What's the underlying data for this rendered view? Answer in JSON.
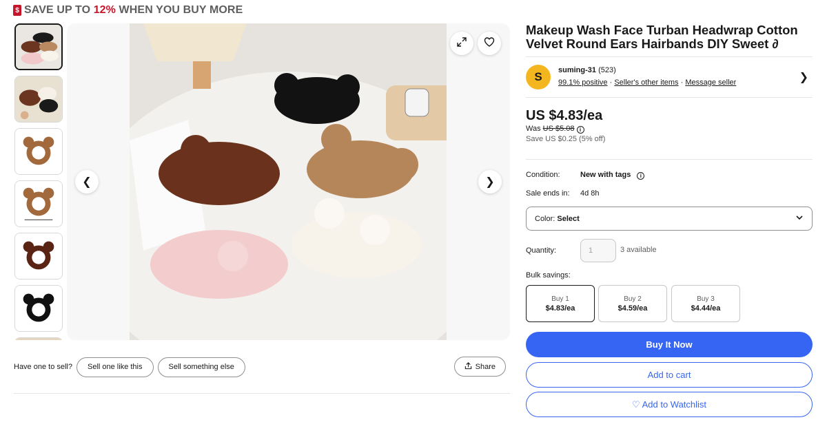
{
  "promo": {
    "icon": "$",
    "text_before": "SAVE UP TO ",
    "percent": "12%",
    "text_after": " WHEN YOU BUY MORE",
    "accent_color": "#c7162b"
  },
  "gallery": {
    "thumbnails": [
      {
        "name": "thumb-1",
        "active": true
      },
      {
        "name": "thumb-2",
        "active": false
      },
      {
        "name": "thumb-3",
        "active": false
      },
      {
        "name": "thumb-4",
        "active": false
      },
      {
        "name": "thumb-5",
        "active": false
      },
      {
        "name": "thumb-6",
        "active": false
      },
      {
        "name": "thumb-7",
        "active": false
      }
    ],
    "prev_icon": "chevron-left-icon",
    "next_icon": "chevron-right-icon",
    "expand_icon": "expand-icon",
    "heart_icon": "heart-icon"
  },
  "sell": {
    "label": "Have one to sell?",
    "sell_one": "Sell one like this",
    "sell_else": "Sell something else",
    "share": "Share"
  },
  "listing": {
    "title": "Makeup Wash Face Turban Headwrap Cotton Velvet Round Ears Hairbands DIY Sweet ∂",
    "seller": {
      "initial": "S",
      "name": "suming-31",
      "feedback_count": "(523)",
      "positive": "99.1% positive",
      "other_items": "Seller's other items",
      "message": "Message seller",
      "avatar_color": "#f3b61f"
    },
    "price": "US $4.83/ea",
    "was_label": "Was",
    "was_price": "US $5.08",
    "save_text": "Save US $0.25 (5% off)",
    "condition_label": "Condition:",
    "condition_value": "New with tags",
    "sale_label": "Sale ends in:",
    "sale_value": "4d 8h",
    "color_label": "Color:",
    "color_value": "Select",
    "quantity_label": "Quantity:",
    "quantity_value": "1",
    "available": "3 available",
    "bulk_label": "Bulk savings:",
    "bulk": [
      {
        "qty": "Buy 1",
        "price": "$4.83/ea",
        "active": true
      },
      {
        "qty": "Buy 2",
        "price": "$4.59/ea",
        "active": false
      },
      {
        "qty": "Buy 3",
        "price": "$4.44/ea",
        "active": false
      }
    ],
    "buy_now": "Buy It Now",
    "add_to_cart": "Add to cart",
    "watchlist": "Add to Watchlist",
    "accent_color": "#3665f3"
  }
}
